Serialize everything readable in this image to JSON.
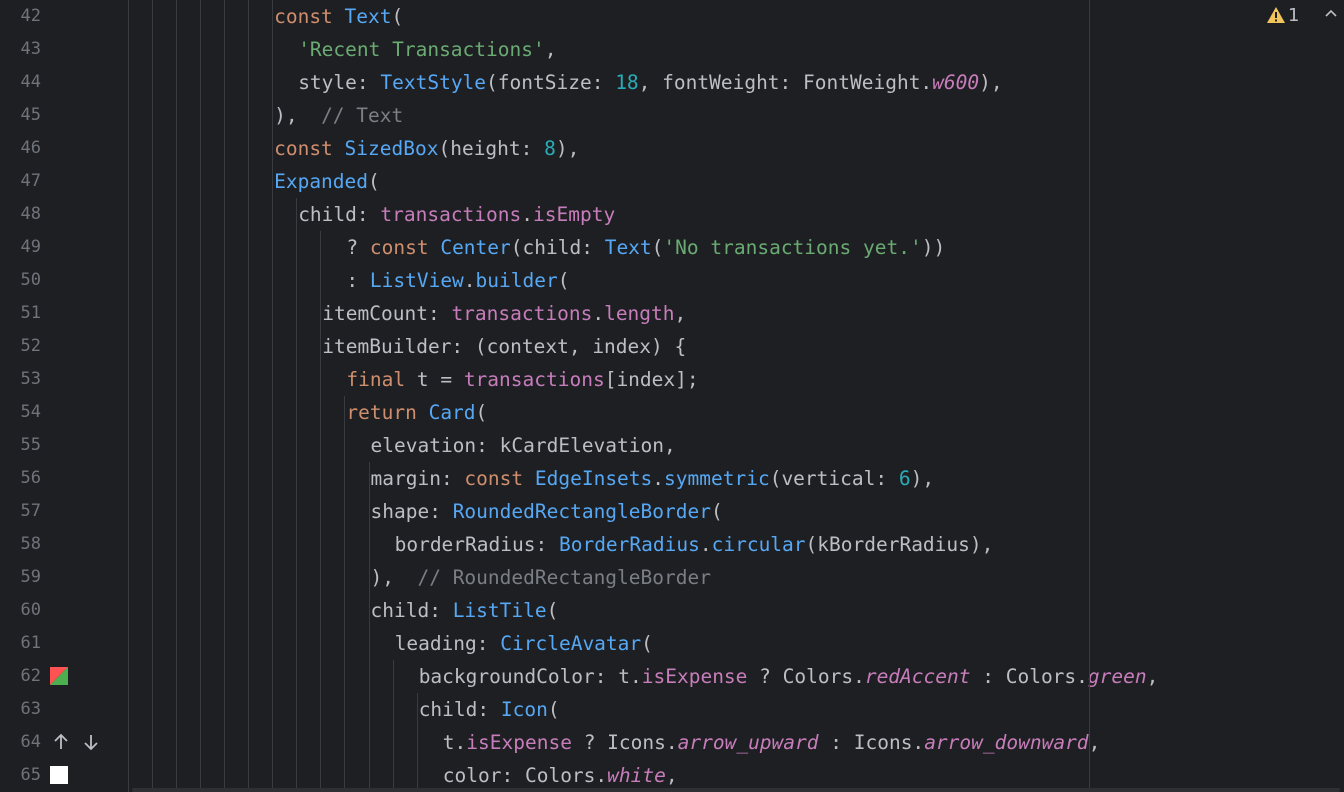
{
  "editor": {
    "warning_count": "1",
    "lines": [
      {
        "n": "42",
        "indent": 6,
        "tokens": [
          [
            "kw",
            "const "
          ],
          [
            "cls",
            "Text"
          ],
          [
            "p",
            "("
          ]
        ]
      },
      {
        "n": "43",
        "indent": 7,
        "tokens": [
          [
            "str",
            "'Recent Transactions'"
          ],
          [
            "p",
            ","
          ]
        ]
      },
      {
        "n": "44",
        "indent": 7,
        "tokens": [
          [
            "p",
            "style: "
          ],
          [
            "cls",
            "TextStyle"
          ],
          [
            "p",
            "(fontSize: "
          ],
          [
            "num",
            "18"
          ],
          [
            "p",
            ", fontWeight: FontWeight."
          ],
          [
            "it",
            "w600"
          ],
          [
            "p",
            "),"
          ]
        ]
      },
      {
        "n": "45",
        "indent": 6,
        "tokens": [
          [
            "p",
            "),  "
          ],
          [
            "cm",
            "// Text"
          ]
        ]
      },
      {
        "n": "46",
        "indent": 6,
        "tokens": [
          [
            "kw",
            "const "
          ],
          [
            "cls",
            "SizedBox"
          ],
          [
            "p",
            "(height: "
          ],
          [
            "num",
            "8"
          ],
          [
            "p",
            "),"
          ]
        ]
      },
      {
        "n": "47",
        "indent": 6,
        "tokens": [
          [
            "cls",
            "Expanded"
          ],
          [
            "p",
            "("
          ]
        ]
      },
      {
        "n": "48",
        "indent": 7,
        "tokens": [
          [
            "p",
            "child: "
          ],
          [
            "prop",
            "transactions"
          ],
          [
            "p",
            "."
          ],
          [
            "prop",
            "isEmpty"
          ]
        ]
      },
      {
        "n": "49",
        "indent": 9,
        "tokens": [
          [
            "p",
            "? "
          ],
          [
            "kw",
            "const "
          ],
          [
            "cls",
            "Center"
          ],
          [
            "p",
            "(child: "
          ],
          [
            "cls",
            "Text"
          ],
          [
            "p",
            "("
          ],
          [
            "str",
            "'No transactions yet.'"
          ],
          [
            "p",
            "))"
          ]
        ]
      },
      {
        "n": "50",
        "indent": 9,
        "tokens": [
          [
            "p",
            ": "
          ],
          [
            "cls",
            "ListView"
          ],
          [
            "p",
            "."
          ],
          [
            "fn",
            "builder"
          ],
          [
            "p",
            "("
          ]
        ]
      },
      {
        "n": "51",
        "indent": 8,
        "tokens": [
          [
            "p",
            "itemCount: "
          ],
          [
            "prop",
            "transactions"
          ],
          [
            "p",
            "."
          ],
          [
            "prop",
            "length"
          ],
          [
            "p",
            ","
          ]
        ]
      },
      {
        "n": "52",
        "indent": 8,
        "tokens": [
          [
            "p",
            "itemBuilder: (context, index) {"
          ]
        ]
      },
      {
        "n": "53",
        "indent": 9,
        "tokens": [
          [
            "kw",
            "final "
          ],
          [
            "p",
            "t = "
          ],
          [
            "prop",
            "transactions"
          ],
          [
            "p",
            "[index];"
          ]
        ]
      },
      {
        "n": "54",
        "indent": 9,
        "tokens": [
          [
            "kw",
            "return "
          ],
          [
            "cls",
            "Card"
          ],
          [
            "p",
            "("
          ]
        ]
      },
      {
        "n": "55",
        "indent": 10,
        "tokens": [
          [
            "p",
            "elevation: kCardElevation,"
          ]
        ]
      },
      {
        "n": "56",
        "indent": 10,
        "tokens": [
          [
            "p",
            "margin: "
          ],
          [
            "kw",
            "const "
          ],
          [
            "cls",
            "EdgeInsets"
          ],
          [
            "p",
            "."
          ],
          [
            "fn",
            "symmetric"
          ],
          [
            "p",
            "(vertical: "
          ],
          [
            "num",
            "6"
          ],
          [
            "p",
            "),"
          ]
        ]
      },
      {
        "n": "57",
        "indent": 10,
        "tokens": [
          [
            "p",
            "shape: "
          ],
          [
            "cls",
            "RoundedRectangleBorder"
          ],
          [
            "p",
            "("
          ]
        ]
      },
      {
        "n": "58",
        "indent": 11,
        "tokens": [
          [
            "p",
            "borderRadius: "
          ],
          [
            "cls",
            "BorderRadius"
          ],
          [
            "p",
            "."
          ],
          [
            "fn",
            "circular"
          ],
          [
            "p",
            "(kBorderRadius),"
          ]
        ]
      },
      {
        "n": "59",
        "indent": 10,
        "tokens": [
          [
            "p",
            "),  "
          ],
          [
            "cm",
            "// RoundedRectangleBorder"
          ]
        ]
      },
      {
        "n": "60",
        "indent": 10,
        "tokens": [
          [
            "p",
            "child: "
          ],
          [
            "cls",
            "ListTile"
          ],
          [
            "p",
            "("
          ]
        ]
      },
      {
        "n": "61",
        "indent": 11,
        "tokens": [
          [
            "p",
            "leading: "
          ],
          [
            "cls",
            "CircleAvatar"
          ],
          [
            "p",
            "("
          ]
        ]
      },
      {
        "n": "62",
        "indent": 12,
        "tokens": [
          [
            "p",
            "backgroundColor: t."
          ],
          [
            "prop",
            "isExpense"
          ],
          [
            "p",
            " ? Colors."
          ],
          [
            "it",
            "redAccent"
          ],
          [
            "p",
            " : Colors."
          ],
          [
            "it",
            "green"
          ],
          [
            "p",
            ","
          ]
        ]
      },
      {
        "n": "63",
        "indent": 12,
        "tokens": [
          [
            "p",
            "child: "
          ],
          [
            "cls",
            "Icon"
          ],
          [
            "p",
            "("
          ]
        ]
      },
      {
        "n": "64",
        "indent": 13,
        "tokens": [
          [
            "p",
            "t."
          ],
          [
            "prop",
            "isExpense"
          ],
          [
            "p",
            " ? Icons."
          ],
          [
            "it",
            "arrow_upward"
          ],
          [
            "p",
            " : Icons."
          ],
          [
            "it",
            "arrow_downward"
          ],
          [
            "p",
            ","
          ]
        ]
      },
      {
        "n": "65",
        "indent": 13,
        "tokens": [
          [
            "p",
            "color: Colors."
          ],
          [
            "it",
            "white"
          ],
          [
            "p",
            ","
          ]
        ]
      }
    ]
  },
  "colors": {
    "background": "#1e1f22",
    "keyword": "#cf8e6d",
    "class": "#56a8f5",
    "string": "#6aab73",
    "number": "#2aacb8",
    "property": "#c77dbb",
    "comment": "#7a7e85",
    "warning": "#f2c55c",
    "swatch_red": "#ff5252",
    "swatch_green": "#4caf50",
    "swatch_white": "#ffffff"
  },
  "icons": {
    "warning": "warning-triangle-icon",
    "collapse": "chevron-up-icon",
    "nav_up": "arrow-up-icon",
    "nav_down": "arrow-down-icon"
  }
}
